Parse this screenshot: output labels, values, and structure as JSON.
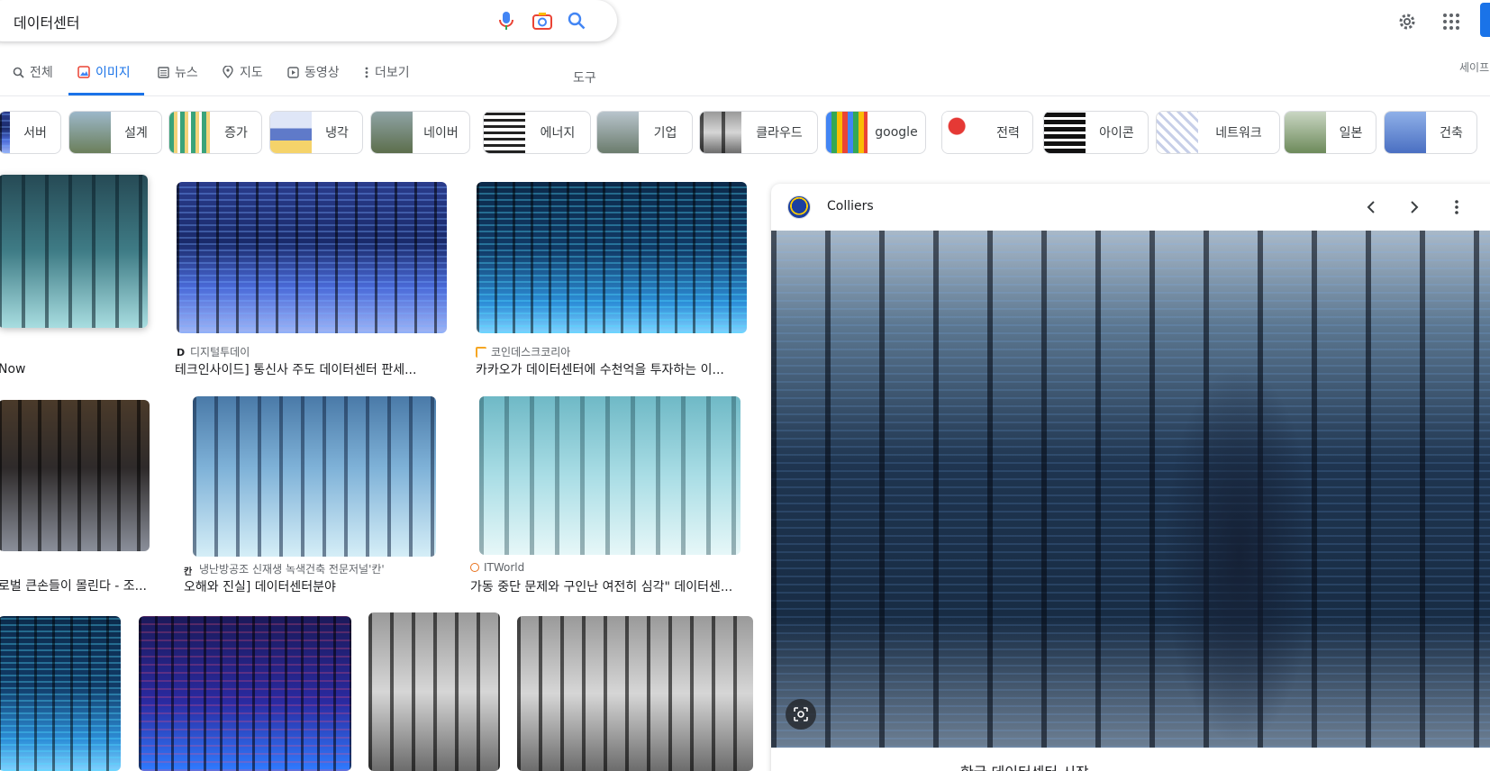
{
  "search": {
    "query": "데이터센터"
  },
  "tabs": [
    {
      "label": "전체",
      "icon": "search-icon",
      "active": false
    },
    {
      "label": "이미지",
      "icon": "image-icon",
      "active": true
    },
    {
      "label": "뉴스",
      "icon": "news-icon",
      "active": false
    },
    {
      "label": "지도",
      "icon": "map-pin-icon",
      "active": false
    },
    {
      "label": "동영상",
      "icon": "video-icon",
      "active": false
    },
    {
      "label": "더보기",
      "icon": "more-vert-icon",
      "active": false
    }
  ],
  "tools_label": "도구",
  "safe_search_label": "세이프",
  "chips": [
    "서버",
    "설계",
    "증가",
    "냉각",
    "네이버",
    "에너지",
    "기업",
    "클라우드",
    "google",
    "전력",
    "아이콘",
    "네트워크",
    "일본",
    "건축"
  ],
  "results": {
    "r1c1": {
      "title": "Now"
    },
    "r1c2": {
      "source": "디지털투데이",
      "title": "테크인사이드] 통신사 주도 데이터센터 판세..."
    },
    "r1c3": {
      "source": "코인데스크코리아",
      "title": "카카오가 데이터센터에 수천억을 투자하는 이..."
    },
    "r2c1": {
      "title": "로벌 큰손들이 몰린다 - 조..."
    },
    "r2c2": {
      "source": "냉난방공조 신재생 녹색건축 전문저널'칸'",
      "title": "오해와 진실] 데이터센터분야"
    },
    "r2c3": {
      "source": "ITWorld",
      "title": "가동 중단 문제와 구인난 여전히 심각\" 데이터센..."
    }
  },
  "preview": {
    "site": "Colliers",
    "title": "한국 데이터센터 시장"
  },
  "colors": {
    "accent": "#1a73e8",
    "text": "#202124",
    "muted": "#5f6368"
  }
}
